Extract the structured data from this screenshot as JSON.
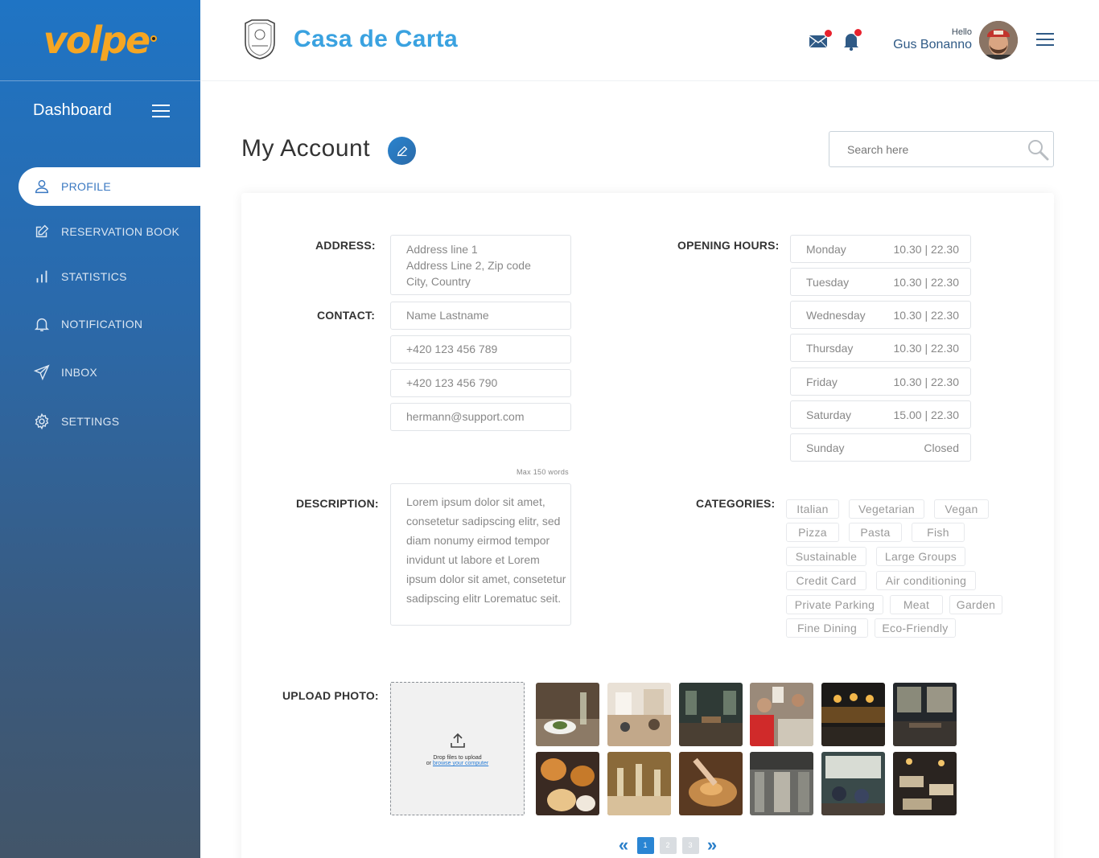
{
  "sidebar": {
    "logo_text": "volpe",
    "dashboard_title": "Dashboard",
    "items": [
      {
        "label": "PROFILE",
        "icon": "user-icon",
        "active": true
      },
      {
        "label": "RESERVATION BOOK",
        "icon": "edit-icon",
        "active": false
      },
      {
        "label": "STATISTICS",
        "icon": "bar-chart-icon",
        "active": false
      },
      {
        "label": "NOTIFICATION",
        "icon": "bell-icon",
        "active": false
      },
      {
        "label": "INBOX",
        "icon": "send-icon",
        "active": false
      },
      {
        "label": "SETTINGS",
        "icon": "gear-icon",
        "active": false
      }
    ]
  },
  "header": {
    "restaurant_name": "Casa de Carta",
    "greeting": "Hello",
    "user_name": "Gus Bonanno"
  },
  "page": {
    "title": "My Account",
    "search_placeholder": "Search here"
  },
  "form": {
    "address_label": "ADDRESS:",
    "address_lines": [
      "Address line 1",
      "Address Line 2, Zip code",
      "City, Country"
    ],
    "contact_label": "CONTACT:",
    "contact_name": "Name Lastname",
    "phone_1": "+420 123 456 789",
    "phone_2": "+420 123 456 790",
    "email": "hermann@support.com",
    "opening_hours_label": "OPENING HOURS:",
    "hours": [
      {
        "day": "Monday",
        "time": "10.30 | 22.30"
      },
      {
        "day": "Tuesday",
        "time": "10.30 | 22.30"
      },
      {
        "day": "Wednesday",
        "time": "10.30 | 22.30"
      },
      {
        "day": "Thursday",
        "time": "10.30 | 22.30"
      },
      {
        "day": "Friday",
        "time": "10.30 | 22.30"
      },
      {
        "day": "Saturday",
        "time": "15.00 | 22.30"
      },
      {
        "day": "Sunday",
        "time": "Closed"
      }
    ],
    "max_words_note": "Max 150 words",
    "description_label": "DESCRIPTION:",
    "description": "Lorem ipsum dolor sit amet, consetetur sadipscing elitr, sed diam nonumy eirmod tempor invidunt ut labore et Lorem ipsum dolor sit amet, consetetur sadipscing elitr Lorematuc seit.",
    "categories_label": "CATEGORIES:",
    "categories": [
      "Italian",
      "Vegetarian",
      "Vegan",
      "Pizza",
      "Pasta",
      "Fish",
      "Sustainable",
      "Large Groups",
      "Credit Card",
      "Air conditioning",
      "Private Parking",
      "Meat",
      "Garden",
      "Fine Dining",
      "Eco-Friendly"
    ],
    "upload_label": "UPLOAD PHOTO:",
    "upload_text_1": "Drop files to upload",
    "upload_text_2_prefix": "or ",
    "upload_link": "browse your computer"
  },
  "pagination": {
    "pages": [
      "1",
      "2",
      "3"
    ],
    "current": "1"
  },
  "colors": {
    "accent": "#2a85d3",
    "brand_blue": "#3aa2e0",
    "logo_orange": "#f5a623",
    "badge_red": "#e8222e"
  }
}
